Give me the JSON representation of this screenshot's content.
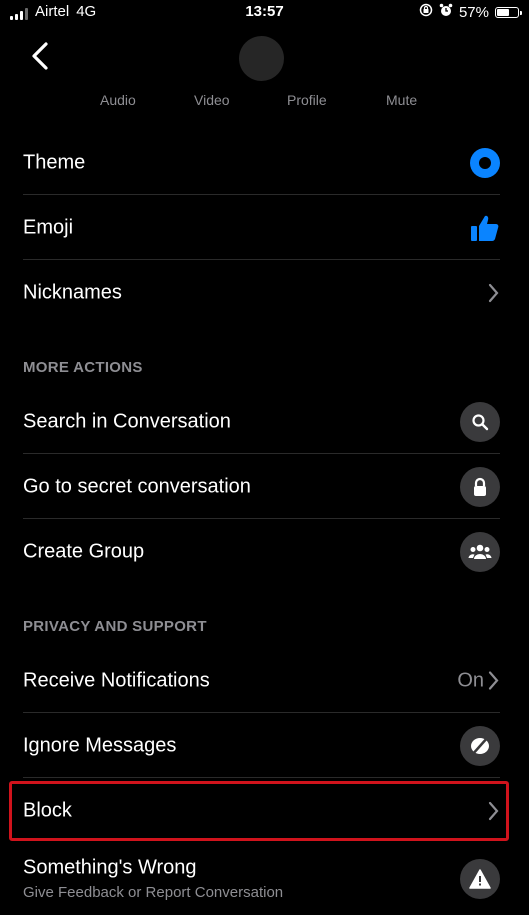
{
  "status_bar": {
    "carrier": "Airtel",
    "network": "4G",
    "time": "13:57",
    "battery": "57%"
  },
  "header": {
    "actions": [
      {
        "label": "Audio"
      },
      {
        "label": "Video"
      },
      {
        "label": "Profile"
      },
      {
        "label": "Mute"
      }
    ]
  },
  "settings": {
    "theme": "Theme",
    "emoji": "Emoji",
    "nicknames": "Nicknames"
  },
  "more_actions": {
    "heading": "MORE ACTIONS",
    "search": "Search in Conversation",
    "secret": "Go to secret conversation",
    "group": "Create Group"
  },
  "privacy": {
    "heading": "PRIVACY AND SUPPORT",
    "notifications": "Receive Notifications",
    "notifications_value": "On",
    "ignore": "Ignore Messages",
    "block": "Block",
    "wrong": "Something's Wrong",
    "wrong_sub": "Give Feedback or Report Conversation"
  },
  "colors": {
    "accent": "#0a84ff",
    "highlight": "#d0131c",
    "secondary_text": "#8e8e93"
  }
}
